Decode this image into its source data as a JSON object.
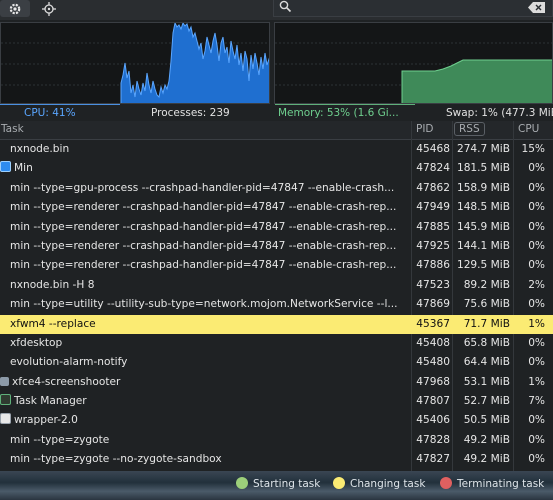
{
  "toolbar": {
    "settings_icon": "gear-icon",
    "target_icon": "crosshair-icon",
    "search_placeholder": "",
    "search_value": ""
  },
  "status": {
    "cpu": "CPU: 41%",
    "processes": "Processes: 239",
    "memory": "Memory: 53% (1.6 Gi...",
    "swap": "Swap: 1% (477.3 MiB /..."
  },
  "columns": {
    "task": "Task",
    "pid": "PID",
    "rss": "RSS",
    "cpu": "CPU"
  },
  "rows": [
    {
      "name": "nxnode.bin",
      "pid": "45468",
      "rss": "274.7 MiB",
      "cpu": "15%"
    },
    {
      "name": "Min",
      "pid": "47824",
      "rss": "181.5 MiB",
      "cpu": "0%"
    },
    {
      "name": "min --type=gpu-process --crashpad-handler-pid=47847 --enable-crash...",
      "pid": "47862",
      "rss": "158.9 MiB",
      "cpu": "0%"
    },
    {
      "name": "min --type=renderer --crashpad-handler-pid=47847 --enable-crash-rep...",
      "pid": "47949",
      "rss": "148.5 MiB",
      "cpu": "0%"
    },
    {
      "name": "min --type=renderer --crashpad-handler-pid=47847 --enable-crash-rep...",
      "pid": "47885",
      "rss": "145.9 MiB",
      "cpu": "0%"
    },
    {
      "name": "min --type=renderer --crashpad-handler-pid=47847 --enable-crash-rep...",
      "pid": "47925",
      "rss": "144.1 MiB",
      "cpu": "0%"
    },
    {
      "name": "min --type=renderer --crashpad-handler-pid=47847 --enable-crash-rep...",
      "pid": "47886",
      "rss": "129.5 MiB",
      "cpu": "0%"
    },
    {
      "name": "nxnode.bin -H 8",
      "pid": "47523",
      "rss": "89.2 MiB",
      "cpu": "2%"
    },
    {
      "name": "min --type=utility --utility-sub-type=network.mojom.NetworkService --l...",
      "pid": "47869",
      "rss": "75.6 MiB",
      "cpu": "0%"
    },
    {
      "name": "xfwm4 --replace",
      "pid": "45367",
      "rss": "71.7 MiB",
      "cpu": "1%"
    },
    {
      "name": "xfdesktop",
      "pid": "45408",
      "rss": "65.8 MiB",
      "cpu": "0%"
    },
    {
      "name": "evolution-alarm-notify",
      "pid": "45480",
      "rss": "64.4 MiB",
      "cpu": "0%"
    },
    {
      "name": "xfce4-screenshooter",
      "pid": "47968",
      "rss": "53.1 MiB",
      "cpu": "1%"
    },
    {
      "name": "Task Manager",
      "pid": "47807",
      "rss": "52.7 MiB",
      "cpu": "7%"
    },
    {
      "name": "wrapper-2.0",
      "pid": "45406",
      "rss": "50.5 MiB",
      "cpu": "0%"
    },
    {
      "name": "min --type=zygote",
      "pid": "47828",
      "rss": "49.2 MiB",
      "cpu": "0%"
    },
    {
      "name": "min --type=zygote --no-zygote-sandbox",
      "pid": "47827",
      "rss": "49.2 MiB",
      "cpu": "0%"
    }
  ],
  "legend": {
    "starting": "Starting task",
    "changing": "Changing task",
    "terminating": "Terminating task"
  },
  "colors": {
    "cpu": "#4a90e2",
    "memory": "#5fb07a",
    "highlight": "#fbeb73",
    "starting": "#9ccf7a",
    "changing": "#fbeb73",
    "terminating": "#e06060"
  }
}
